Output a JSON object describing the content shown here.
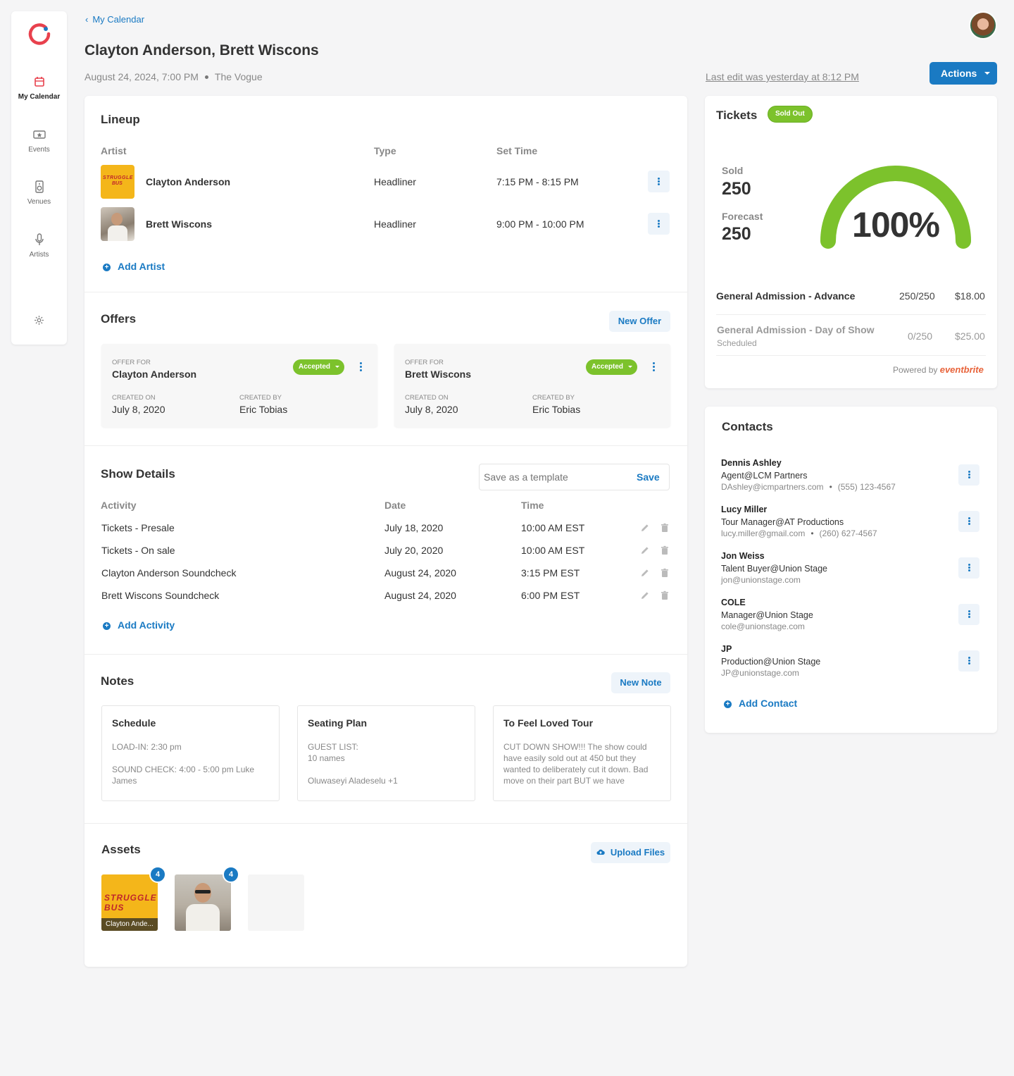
{
  "sidebar": {
    "items": [
      {
        "label": "My Calendar",
        "icon": "calendar-icon"
      },
      {
        "label": "Events",
        "icon": "ticket-icon"
      },
      {
        "label": "Venues",
        "icon": "speaker-icon"
      },
      {
        "label": "Artists",
        "icon": "microphone-icon"
      }
    ],
    "brand_color": "#e8414d"
  },
  "header": {
    "back_label": "My Calendar",
    "title": "Clayton Anderson, Brett Wiscons",
    "datetime": "August 24, 2024, 7:00 PM",
    "venue": "The Vogue",
    "last_edit": "Last edit was yesterday at 8:12 PM",
    "actions_label": "Actions"
  },
  "lineup": {
    "title": "Lineup",
    "columns": [
      "Artist",
      "Type",
      "Set Time"
    ],
    "rows": [
      {
        "artist": "Clayton Anderson",
        "type": "Headliner",
        "set_time": "7:15 PM - 8:15 PM"
      },
      {
        "artist": "Brett Wiscons",
        "type": "Headliner",
        "set_time": "9:00 PM - 10:00 PM"
      }
    ],
    "add_label": "Add Artist"
  },
  "offers": {
    "title": "Offers",
    "new_label": "New Offer",
    "offer_for_label": "OFFER FOR",
    "created_on_label": "CREATED ON",
    "created_by_label": "CREATED BY",
    "items": [
      {
        "name": "Clayton Anderson",
        "status": "Accepted",
        "created_on": "July 8, 2020",
        "created_by": "Eric Tobias"
      },
      {
        "name": "Brett Wiscons",
        "status": "Accepted",
        "created_on": "July 8, 2020",
        "created_by": "Eric Tobias"
      }
    ]
  },
  "show_details": {
    "title": "Show Details",
    "template_placeholder": "Save as a template",
    "save_label": "Save",
    "columns": [
      "Activity",
      "Date",
      "Time"
    ],
    "rows": [
      {
        "activity": "Tickets - Presale",
        "date": "July 18, 2020",
        "time": "10:00 AM EST"
      },
      {
        "activity": "Tickets - On sale",
        "date": "July 20, 2020",
        "time": "10:00 AM EST"
      },
      {
        "activity": "Clayton Anderson Soundcheck",
        "date": "August 24, 2020",
        "time": "3:15 PM EST"
      },
      {
        "activity": "Brett Wiscons Soundcheck",
        "date": "August 24, 2020",
        "time": "6:00 PM EST"
      }
    ],
    "add_label": "Add Activity"
  },
  "notes": {
    "title": "Notes",
    "new_label": "New Note",
    "items": [
      {
        "title": "Schedule",
        "lines": [
          "LOAD-IN: 2:30 pm",
          "",
          "SOUND CHECK: 4:00 - 5:00 pm Luke James"
        ]
      },
      {
        "title": "Seating Plan",
        "lines": [
          "GUEST LIST:",
          "10 names",
          "",
          "Oluwaseyi Aladeselu +1"
        ]
      },
      {
        "title": "To Feel Loved Tour",
        "lines": [
          "CUT DOWN SHOW!!! The show could have easily sold out at 450 but they wanted to deliberately cut it down. Bad move on their part BUT we have"
        ]
      }
    ]
  },
  "assets": {
    "title": "Assets",
    "upload_label": "Upload Files",
    "items": [
      {
        "count": "4",
        "caption": "Clayton Ande...",
        "art_text": "STRUGGLE BUS"
      },
      {
        "count": "4",
        "caption": ""
      }
    ]
  },
  "tickets": {
    "title": "Tickets",
    "status": "Sold Out",
    "sold_label": "Sold",
    "sold": "250",
    "forecast_label": "Forecast",
    "forecast": "250",
    "percent_text": "100%",
    "percent_value": 1.0,
    "gauge_color": "#7cc22c",
    "rows": [
      {
        "name": "General Admission - Advance",
        "qty": "250/250",
        "price": "$18.00",
        "sub": ""
      },
      {
        "name": "General Admission - Day of Show",
        "qty": "0/250",
        "price": "$25.00",
        "sub": "Scheduled"
      }
    ],
    "powered_by": "Powered by",
    "provider": "eventbrite"
  },
  "contacts": {
    "title": "Contacts",
    "items": [
      {
        "name": "Dennis Ashley",
        "role": "Agent@LCM Partners",
        "email": "DAshley@icmpartners.com",
        "phone": "(555) 123-4567"
      },
      {
        "name": "Lucy Miller",
        "role": "Tour Manager@AT Productions",
        "email": "lucy.miller@gmail.com",
        "phone": "(260) 627-4567"
      },
      {
        "name": "Jon Weiss",
        "role": "Talent Buyer@Union Stage",
        "email": "jon@unionstage.com",
        "phone": ""
      },
      {
        "name": "COLE",
        "role": "Manager@Union Stage",
        "email": "cole@unionstage.com",
        "phone": ""
      },
      {
        "name": "JP",
        "role": "Production@Union Stage",
        "email": "JP@unionstage.com",
        "phone": ""
      }
    ],
    "add_label": "Add Contact"
  },
  "colors": {
    "accent": "#1a7ac3",
    "success": "#7cc22c"
  }
}
